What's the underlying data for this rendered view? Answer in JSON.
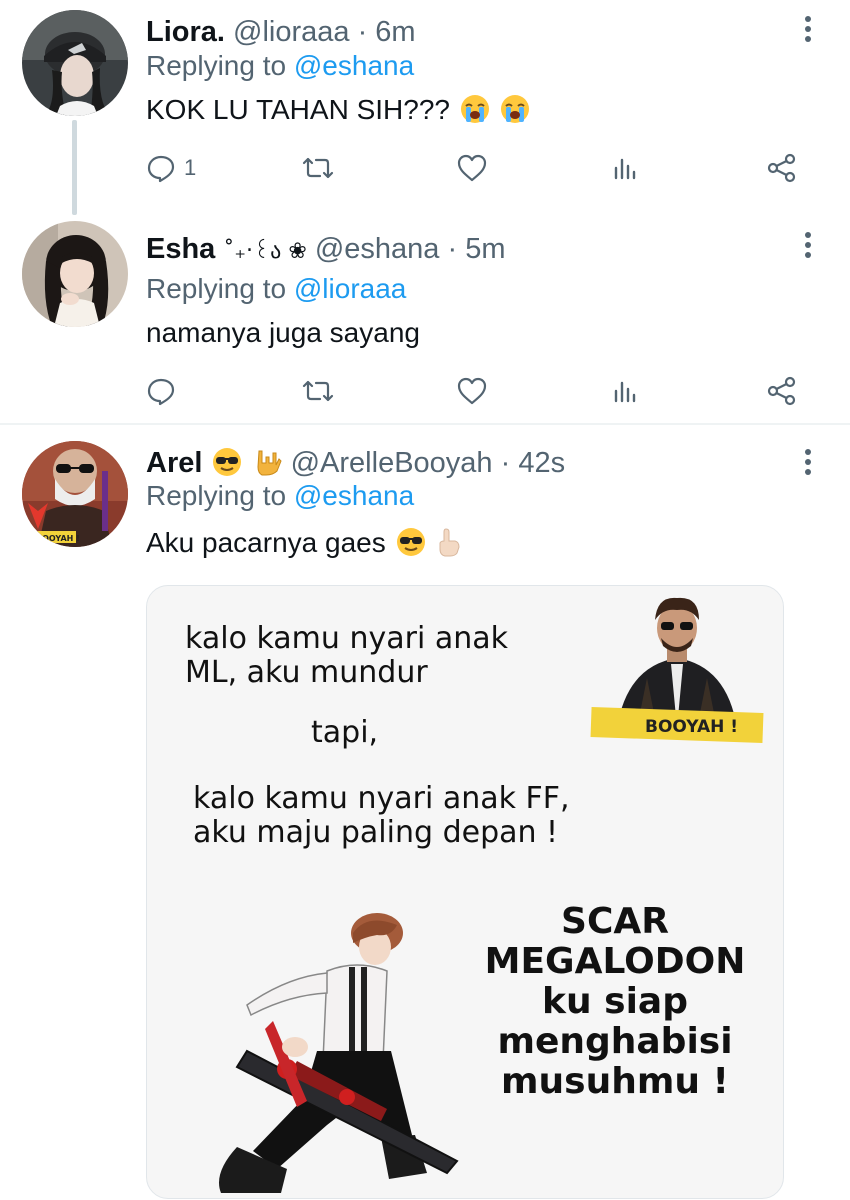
{
  "tweets": [
    {
      "name": "Liora.",
      "handle": "@lioraaa",
      "time": "· 6m",
      "replying_prefix": "Replying to ",
      "replying_to": "@eshana",
      "text": "KOK LU TAHAN SIH???",
      "text_emojis": [
        "loudly-crying-face",
        "loudly-crying-face"
      ],
      "reply_count": "1"
    },
    {
      "name": "Esha",
      "name_decoration": "˚₊‧꒰ა ❀",
      "handle": "@eshana",
      "time": "· 5m",
      "replying_prefix": "Replying to ",
      "replying_to": "@lioraaa",
      "text": "namanya juga sayang",
      "reply_count": ""
    },
    {
      "name": "Arel",
      "name_emojis": [
        "sunglasses-face",
        "love-you-gesture"
      ],
      "handle": "@ArelleBooyah",
      "time": "· 42s",
      "replying_prefix": "Replying to ",
      "replying_to": "@eshana",
      "text": "Aku pacarnya gaes",
      "text_emojis": [
        "sunglasses-face",
        "index-pointing-up"
      ],
      "avatar_badge": "BOOYAH !"
    }
  ],
  "meme": {
    "line1": "kalo kamu nyari anak",
    "line2": "ML, aku mundur",
    "line3": "tapi,",
    "line4": "kalo kamu nyari anak FF,",
    "line5": "aku maju paling depan !",
    "badge": "BOOYAH !",
    "bold_lines": [
      "SCAR",
      "MEGALODON",
      "ku siap",
      "menghabisi",
      "musuhmu !"
    ]
  },
  "icons": [
    "reply-icon",
    "retweet-icon",
    "like-icon",
    "analytics-icon",
    "share-icon",
    "more-options-icon"
  ],
  "colors": {
    "text": "#0f1419",
    "muted": "#536471",
    "link": "#1d9bf0",
    "thread_line": "#cfd9de",
    "divider": "#eff3f4"
  }
}
